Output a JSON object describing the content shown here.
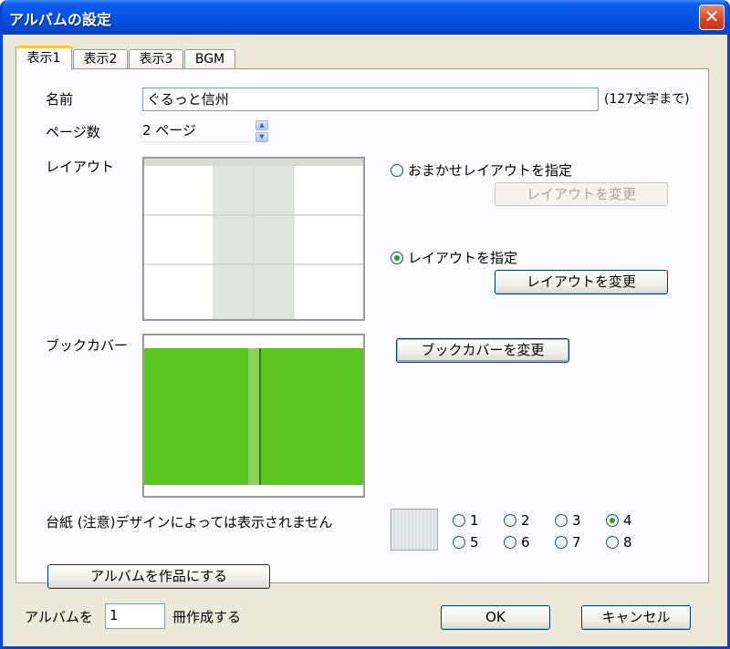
{
  "window": {
    "title": "アルバムの設定",
    "close_glyph": "✕"
  },
  "tabs": [
    {
      "label": "表示1",
      "active": true
    },
    {
      "label": "表示2",
      "active": false
    },
    {
      "label": "表示3",
      "active": false
    },
    {
      "label": "BGM",
      "active": false
    }
  ],
  "name_field": {
    "label": "名前",
    "value": "ぐるっと信州",
    "hint": "(127文字まで)"
  },
  "pages_field": {
    "label": "ページ数",
    "value": "2 ページ",
    "up": "▲",
    "down": "▼"
  },
  "layout": {
    "label": "レイアウト",
    "auto_option": "おまかせレイアウトを指定",
    "auto_button": "レイアウトを変更",
    "manual_option": "レイアウトを指定",
    "manual_button": "レイアウトを変更",
    "selected": "manual"
  },
  "book_cover": {
    "label": "ブックカバー",
    "button": "ブックカバーを変更",
    "color": "#5cc521"
  },
  "mount": {
    "label": "台紙 (注意)デザインによっては表示されません",
    "options": [
      "1",
      "2",
      "3",
      "4",
      "5",
      "6",
      "7",
      "8"
    ],
    "selected": "4"
  },
  "make_album_button": "アルバムを作品にする",
  "footer": {
    "prefix": "アルバムを",
    "count": "1",
    "suffix": "冊作成する",
    "ok": "OK",
    "cancel": "キャンセル"
  },
  "colors": {
    "title_bar": "#0653e6",
    "dialog_bg": "#ece9d8",
    "tab_highlight": "#ffc83c"
  }
}
